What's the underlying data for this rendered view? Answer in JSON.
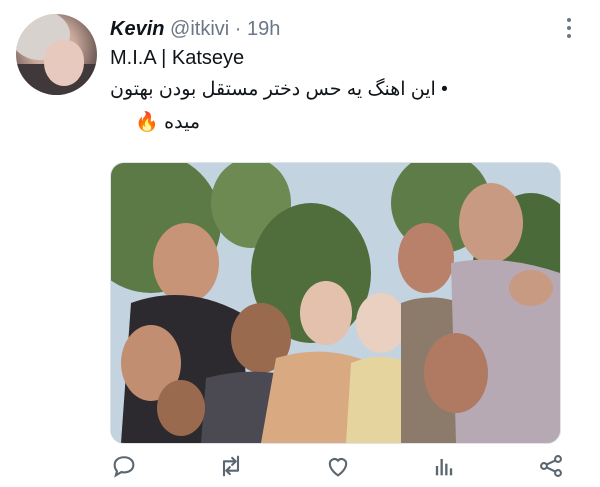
{
  "tweet": {
    "author_name": "Kevin",
    "author_handle": "@itkivi",
    "separator": "·",
    "timestamp": "19h",
    "line1": "M.I.A | Katseye",
    "line2": "• این اهنگ یه حس دختر مستقل بودن بهتون",
    "line3_text": "میده",
    "line3_emoji": "🔥"
  },
  "icons": {
    "more": "more-options-icon",
    "reply": "reply-icon",
    "retweet": "retweet-icon",
    "like": "like-icon",
    "views": "views-icon",
    "share": "share-icon"
  },
  "colors": {
    "text": "#0f1419",
    "secondary": "#6b7785",
    "icon": "#5b6770"
  }
}
